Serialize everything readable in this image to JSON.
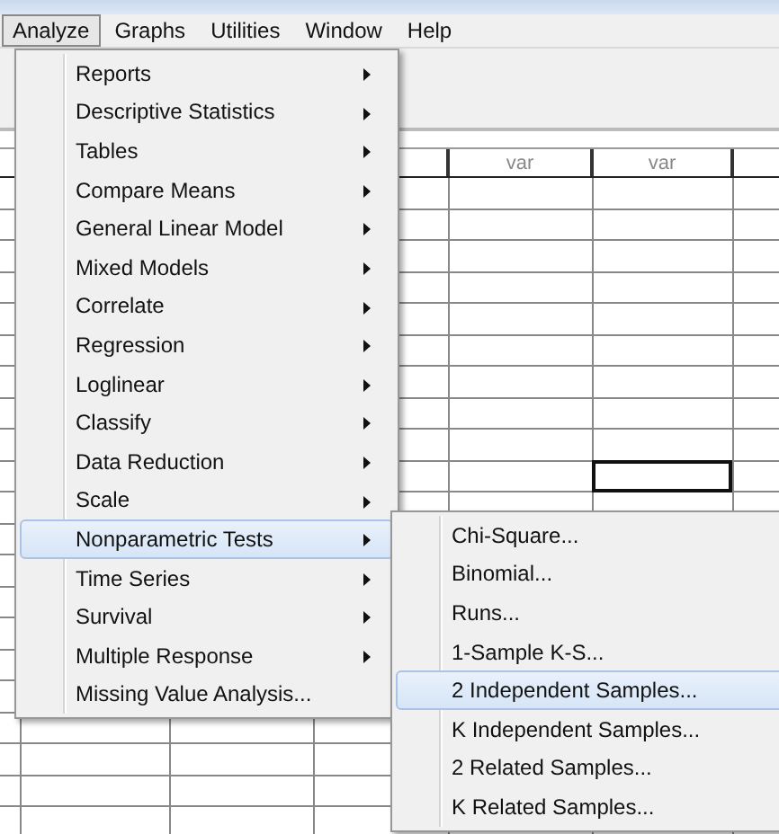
{
  "menubar": [
    {
      "label": "Analyze",
      "selected": true
    },
    {
      "label": "Graphs",
      "selected": false
    },
    {
      "label": "Utilities",
      "selected": false
    },
    {
      "label": "Window",
      "selected": false
    },
    {
      "label": "Help",
      "selected": false
    }
  ],
  "menu": [
    {
      "label": "Reports",
      "submenu": true,
      "selected": false
    },
    {
      "label": "Descriptive Statistics",
      "submenu": true,
      "selected": false
    },
    {
      "label": "Tables",
      "submenu": true,
      "selected": false
    },
    {
      "label": "Compare Means",
      "submenu": true,
      "selected": false
    },
    {
      "label": "General Linear Model",
      "submenu": true,
      "selected": false
    },
    {
      "label": "Mixed Models",
      "submenu": true,
      "selected": false
    },
    {
      "label": "Correlate",
      "submenu": true,
      "selected": false
    },
    {
      "label": "Regression",
      "submenu": true,
      "selected": false
    },
    {
      "label": "Loglinear",
      "submenu": true,
      "selected": false
    },
    {
      "label": "Classify",
      "submenu": true,
      "selected": false
    },
    {
      "label": "Data Reduction",
      "submenu": true,
      "selected": false
    },
    {
      "label": "Scale",
      "submenu": true,
      "selected": false
    },
    {
      "label": "Nonparametric Tests",
      "submenu": true,
      "selected": true
    },
    {
      "label": "Time Series",
      "submenu": true,
      "selected": false
    },
    {
      "label": "Survival",
      "submenu": true,
      "selected": false
    },
    {
      "label": "Multiple Response",
      "submenu": true,
      "selected": false
    },
    {
      "label": "Missing Value Analysis...",
      "submenu": false,
      "selected": false
    }
  ],
  "submenu": [
    {
      "label": "Chi-Square...",
      "selected": false
    },
    {
      "label": "Binomial...",
      "selected": false
    },
    {
      "label": "Runs...",
      "selected": false
    },
    {
      "label": "1-Sample K-S...",
      "selected": false
    },
    {
      "label": "2 Independent Samples...",
      "selected": true
    },
    {
      "label": "K Independent Samples...",
      "selected": false
    },
    {
      "label": "2 Related Samples...",
      "selected": false
    },
    {
      "label": "K Related Samples...",
      "selected": false
    }
  ],
  "grid": {
    "columns": [
      "var",
      "var"
    ],
    "cell_cursor": true
  }
}
